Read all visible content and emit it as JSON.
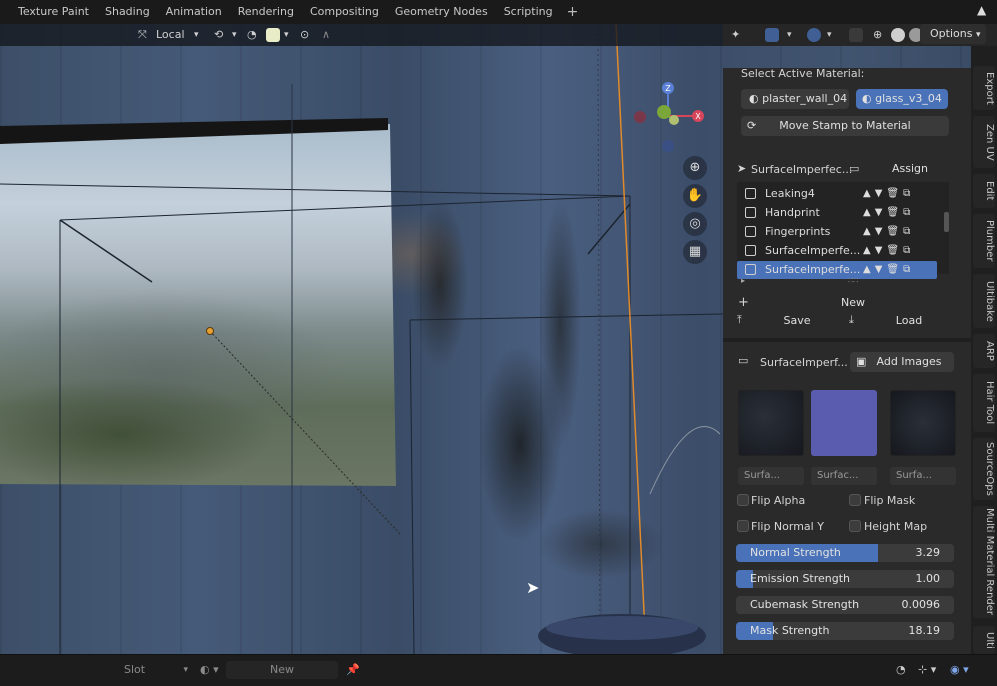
{
  "workspace_tabs": [
    "Texture Paint",
    "Shading",
    "Animation",
    "Rendering",
    "Compositing",
    "Geometry Nodes",
    "Scripting"
  ],
  "add_tab": "+",
  "viewport_header": {
    "orientation": "Local",
    "options_label": "Options"
  },
  "gizmo": {
    "z": "Z",
    "x": "X"
  },
  "panel": {
    "select_material_label": "Select Active Material:",
    "materials": [
      "plaster_wall_04",
      "glass_v3_04"
    ],
    "move_stamp_label": "Move Stamp to Material",
    "active_stamp": "SurfaceImperfec...",
    "assign_label": "Assign",
    "stamp_list": [
      {
        "name": "Leaking4",
        "selected": false
      },
      {
        "name": "Handprint",
        "selected": false
      },
      {
        "name": "Fingerprints",
        "selected": false
      },
      {
        "name": "SurfaceImperfe...",
        "selected": false
      },
      {
        "name": "SurfaceImperfe...",
        "selected": true
      }
    ],
    "new_label": "New",
    "save_label": "Save",
    "load_label": "Load",
    "image_stamp": "SurfaceImperf...",
    "add_images_label": "Add Images",
    "thumb_captions": [
      "Surfa...",
      "Surfac...",
      "Surfa..."
    ],
    "checkboxes": [
      "Flip Alpha",
      "Flip Mask",
      "Flip Normal Y",
      "Height Map"
    ],
    "sliders": [
      {
        "label": "Normal Strength",
        "value": "3.29",
        "fill": 0.65
      },
      {
        "label": "Emission Strength",
        "value": "1.00",
        "fill": 0.08
      },
      {
        "label": "Cubemask Strength",
        "value": "0.0096",
        "fill": 0.0
      },
      {
        "label": "Mask Strength",
        "value": "18.19",
        "fill": 0.17
      }
    ]
  },
  "side_tabs": [
    "Export",
    "Zen UV",
    "Edit",
    "Plumber",
    "Ultibake",
    "ARP",
    "Hair Tool",
    "SourceOps",
    "Multi Material Render",
    "Ulti"
  ],
  "bottom_bar": {
    "slot_label": "Slot",
    "new_label": "New"
  },
  "colors": {
    "accent": "#4a72b8",
    "thumb_mid": "#5a5cb0"
  }
}
